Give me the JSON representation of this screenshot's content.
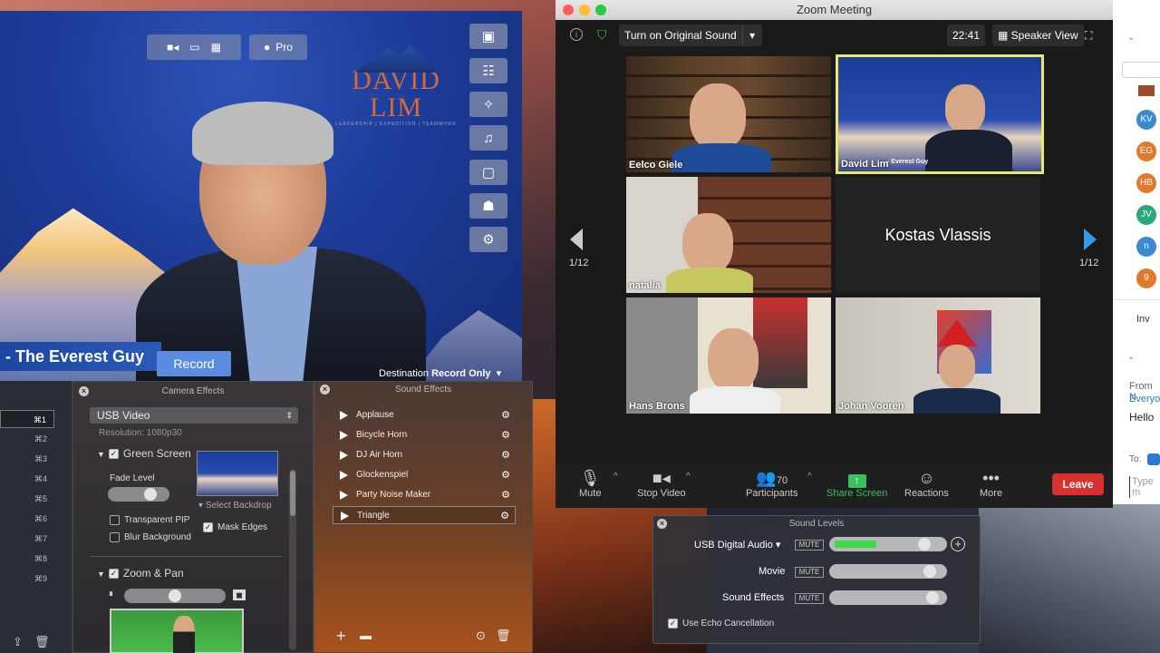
{
  "camera_preview": {
    "mode_pill_label": "Pro",
    "logo_name": "DAVID LIM",
    "logo_tagline": "LEADERSHIP | EXPEDITION | TEAMWORK",
    "lower_third": "- The Everest Guy",
    "record_label": "Record",
    "destination_label": "Destination",
    "destination_value": "Record Only"
  },
  "shortcuts": [
    "⌘1",
    "⌘2",
    "⌘3",
    "⌘4",
    "⌘5",
    "⌘6",
    "⌘7",
    "⌘8",
    "⌘9"
  ],
  "camera_effects": {
    "title": "Camera Effects",
    "source": "USB Video",
    "resolution": "Resolution: 1080p30",
    "green_screen_label": "Green Screen",
    "green_screen_checked": true,
    "fade_level_label": "Fade Level",
    "fade_level": 0.75,
    "select_backdrop_label": "Select Backdrop",
    "transparent_pip_label": "Transparent PIP",
    "transparent_pip_checked": false,
    "blur_background_label": "Blur Background",
    "blur_background_checked": false,
    "mask_edges_label": "Mask Edges",
    "mask_edges_checked": true,
    "zoom_pan_label": "Zoom & Pan",
    "zoom_pan_checked": true,
    "zoom_level": 0.5
  },
  "sound_effects": {
    "title": "Sound Effects",
    "items": [
      "Applause",
      "Bicycle Horn",
      "DJ Air Horn",
      "Glockenspiel",
      "Party Noise Maker",
      "Triangle"
    ],
    "selected": "Triangle"
  },
  "zoom": {
    "window_title": "Zoom Meeting",
    "original_sound_label": "Turn on Original Sound",
    "time": "22:41",
    "view_label": "Speaker View",
    "page_left": "1/12",
    "page_right": "1/12",
    "participants": [
      {
        "name": "Eelco Giele"
      },
      {
        "name": "David Lim",
        "banner": "- Everest Guy"
      },
      {
        "name": "natalia"
      },
      {
        "name": "Kostas Vlassis"
      },
      {
        "name": "Hans Brons"
      },
      {
        "name": "Johan Vooren"
      }
    ],
    "controls": {
      "mute": "Mute",
      "stop_video": "Stop Video",
      "participants": "Participants",
      "participant_count": "70",
      "share_screen": "Share Screen",
      "reactions": "Reactions",
      "more": "More",
      "leave": "Leave"
    }
  },
  "side_panel": {
    "avatars": [
      {
        "initials": "KV",
        "color": "#3a8ad0"
      },
      {
        "initials": "EG",
        "color": "#e07a2a"
      },
      {
        "initials": "HB",
        "color": "#e07a2a"
      },
      {
        "initials": "JV",
        "color": "#2aa878"
      },
      {
        "initials": "n",
        "color": "#3a8ad0"
      },
      {
        "initials": "9",
        "color": "#e07a2a"
      }
    ],
    "invite": "Inv",
    "chat_from": "From",
    "chat_from_partial": "N",
    "chat_to_partial": "Everyo",
    "chat_message": "Hello",
    "to_label": "To:",
    "type_placeholder": "Type m"
  },
  "sound_levels": {
    "title": "Sound Levels",
    "mute_label": "MUTE",
    "usb_label": "USB Digital Audio",
    "usb_level": 0.85,
    "usb_meter": 0.35,
    "movie_label": "Movie",
    "movie_level": 0.9,
    "sfx_label": "Sound Effects",
    "sfx_level": 0.93,
    "echo_label": "Use Echo Cancellation",
    "echo_checked": true
  }
}
